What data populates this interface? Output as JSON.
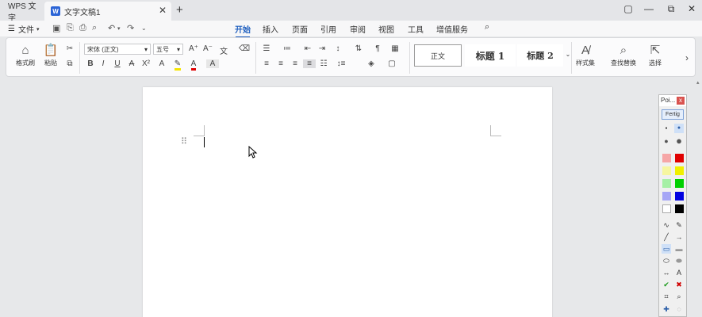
{
  "titlebar": {
    "app_tab": "WPS 文字",
    "doc_tab": "文字文稿1",
    "doc_icon": "W"
  },
  "menu": {
    "file_label": "文件",
    "tabs": [
      "开始",
      "插入",
      "页面",
      "引用",
      "审阅",
      "视图",
      "工具",
      "增值服务"
    ],
    "active_tab": "开始"
  },
  "ribbon": {
    "format_painter": "格式刷",
    "paste": "粘贴",
    "font_name": "宋体 (正文)",
    "font_size": "五号",
    "style_normal": "正文",
    "style_h1": "标题 1",
    "style_h2": "标题 2",
    "style_set": "样式集",
    "find_replace": "查找替换",
    "select": "选择"
  },
  "palette": {
    "title": "Poi...",
    "done_button": "Fertig",
    "colors": [
      "#f6a6a6",
      "#e00000",
      "#f6f6a0",
      "#f0f000",
      "#a6f0a6",
      "#00d000",
      "#a6a6f6",
      "#0000e0",
      "#ffffff",
      "#000000"
    ]
  }
}
